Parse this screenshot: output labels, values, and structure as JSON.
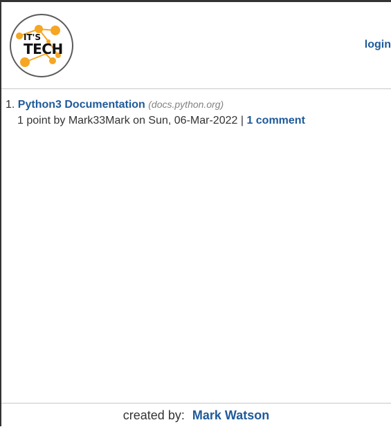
{
  "header": {
    "logo": {
      "line1": "IT'S",
      "line2": "TECH",
      "accent": "#f5a623"
    },
    "login_label": "login"
  },
  "stories": [
    {
      "rank": "1.",
      "title": "Python3 Documentation",
      "domain": "(docs.python.org)",
      "meta_prefix": "1 point by Mark33Mark on Sun, 06-Mar-2022 |",
      "comments": "1 comment"
    }
  ],
  "footer": {
    "prefix": "created by:",
    "author": "Mark Watson"
  },
  "colors": {
    "link": "#1e5a9a",
    "domain": "#828282",
    "border": "#c8c8c8"
  }
}
